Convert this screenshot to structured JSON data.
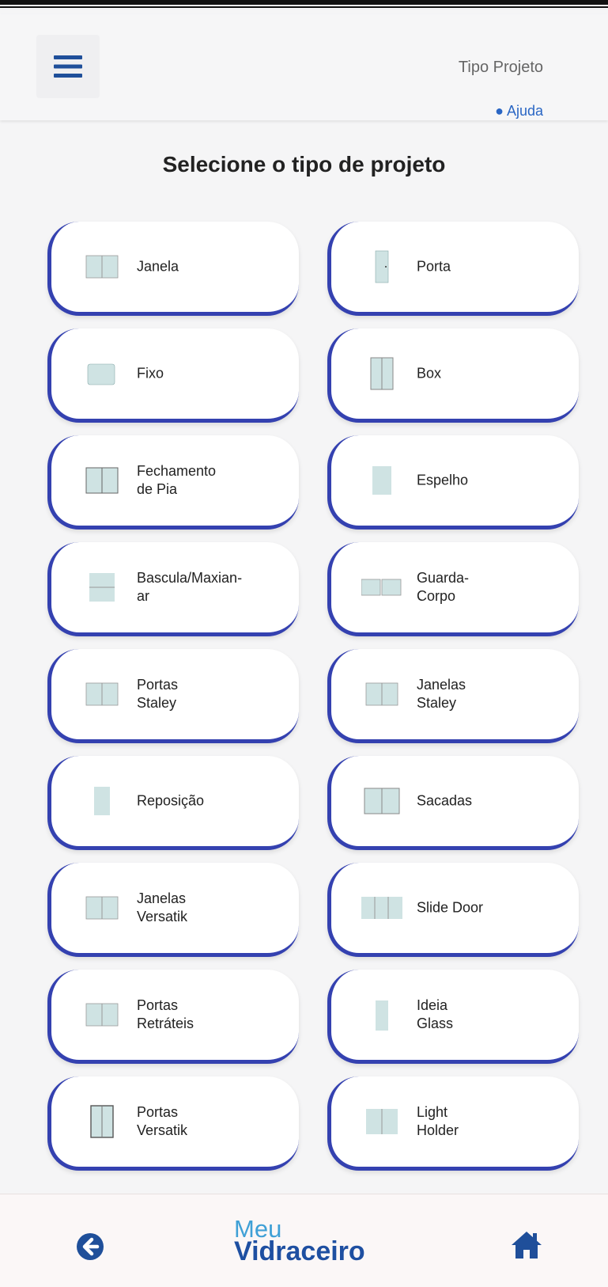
{
  "header": {
    "title": "Tipo Projeto",
    "help_label": "Ajuda"
  },
  "page": {
    "heading": "Selecione o tipo de projeto"
  },
  "project_types": [
    {
      "label": "Janela",
      "icon": "window-glass-icon"
    },
    {
      "label": "Porta",
      "icon": "door-glass-icon"
    },
    {
      "label": "Fixo",
      "icon": "fixed-glass-icon"
    },
    {
      "label": "Box",
      "icon": "shower-box-icon"
    },
    {
      "label": "Fechamento\nde Pia",
      "icon": "sink-enclosure-icon"
    },
    {
      "label": "Espelho",
      "icon": "mirror-icon"
    },
    {
      "label": "Bascula/Maxian-\nar",
      "icon": "tilt-window-icon"
    },
    {
      "label": "Guarda-\nCorpo",
      "icon": "railing-icon"
    },
    {
      "label": "Portas\nStaley",
      "icon": "staley-door-icon"
    },
    {
      "label": "Janelas\nStaley",
      "icon": "staley-window-icon"
    },
    {
      "label": "Reposição",
      "icon": "replacement-glass-icon"
    },
    {
      "label": "Sacadas",
      "icon": "balcony-icon"
    },
    {
      "label": "Janelas\nVersatik",
      "icon": "versatik-window-icon"
    },
    {
      "label": "Slide Door",
      "icon": "slide-door-icon"
    },
    {
      "label": "Portas\nRetráteis",
      "icon": "retractable-door-icon"
    },
    {
      "label": "Ideia\nGlass",
      "icon": "ideia-glass-icon"
    },
    {
      "label": "Portas\nVersatik",
      "icon": "versatik-door-icon"
    },
    {
      "label": "Light\nHolder",
      "icon": "light-holder-icon"
    }
  ],
  "footer": {
    "logo_line1": "Meu",
    "logo_line2": "Vidraceiro"
  },
  "colors": {
    "card_accent": "#3441b0",
    "glass": "#cfe3e3",
    "logo_light": "#3fa0d6",
    "logo_dark": "#1e4fa1"
  }
}
